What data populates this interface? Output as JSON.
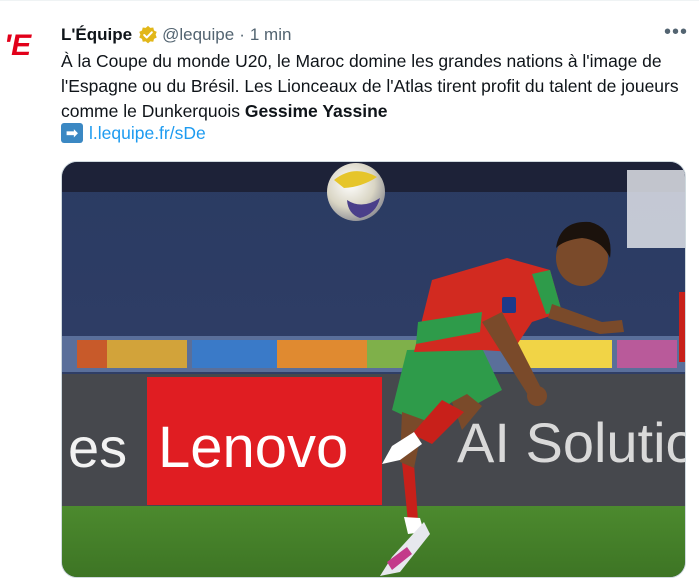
{
  "tweet": {
    "author": "L'Équipe",
    "handle": "@lequipe",
    "separator": "·",
    "time": "1 min",
    "logo_text": "'E",
    "text_main": "À la Coupe du monde U20, le Maroc domine les grandes nations à l'image de l'Espagne ou du Brésil. Les Lionceaux de l'Atlas tirent profit du talent de joueurs comme le Dunkerquois ",
    "text_bold": "Gessime Yassine",
    "link": "l.lequipe.fr/sDe",
    "more_icon": "more-horizontal-icon",
    "verified_icon": "verified-gold-icon"
  },
  "media": {
    "board_text_1": "es",
    "board_text_2": "Lenovo",
    "board_text_3": "AI Solution"
  },
  "colors": {
    "link": "#1d9bf0",
    "secondary": "#536471",
    "brand_red": "#e2001a",
    "verified_gold": "#e2b719"
  }
}
